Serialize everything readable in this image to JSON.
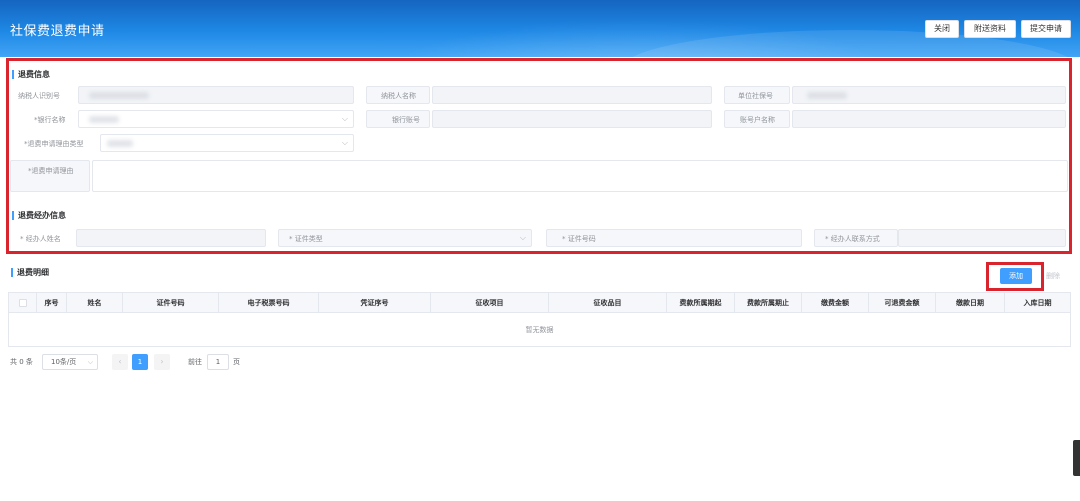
{
  "header": {
    "title": "社保费退费申请",
    "buttons": {
      "close": "关闭",
      "attach": "附送资料",
      "submit": "提交申请"
    }
  },
  "refund_info": {
    "title": "退费信息",
    "fields": {
      "taxpayer_id": "纳税人识别号",
      "taxpayer_name": "纳税人名称",
      "unit_ss_no": "单位社保号",
      "bank_name": "*银行名称",
      "bank_account": "银行账号",
      "account_name": "账号户名称",
      "reason_type": "*退费申请理由类型",
      "reason": "*退费申请理由"
    }
  },
  "agent_info": {
    "title": "退费经办信息",
    "fields": {
      "agent_name": "* 经办人姓名",
      "cert_type": "* 证件类型",
      "cert_no": "* 证件号码",
      "contact": "* 经办人联系方式"
    }
  },
  "detail": {
    "title": "退费明细",
    "add": "添加",
    "delete": "删除",
    "columns": [
      "序号",
      "姓名",
      "证件号码",
      "电子税票号码",
      "凭证序号",
      "征收项目",
      "征收品目",
      "费款所属期起",
      "费款所属期止",
      "缴费金额",
      "可退费金额",
      "缴款日期",
      "入库日期"
    ],
    "empty_text": "暂无数据"
  },
  "pagination": {
    "total": "共 0 条",
    "page_size": "10条/页",
    "current_page": "1",
    "goto_label": "前往",
    "goto_value": "1",
    "page_suffix": "页"
  },
  "colors": {
    "accent": "#409eff",
    "highlight": "#d9232d",
    "header": "#1e88e5"
  }
}
